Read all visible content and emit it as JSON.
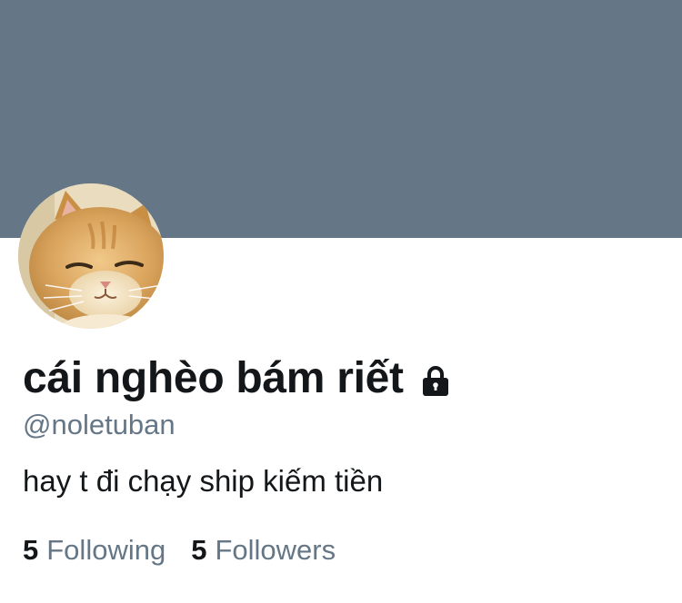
{
  "profile": {
    "banner_color": "#657786",
    "avatar_icon": "orange-cat-photo",
    "display_name": "cái nghèo bám riết",
    "protected_icon": "lock-icon",
    "handle": "@noletuban",
    "bio": "hay t đi chạy ship kiếm tiền"
  },
  "stats": {
    "following_count": "5",
    "following_label": "Following",
    "followers_count": "5",
    "followers_label": "Followers"
  },
  "colors": {
    "primary_text": "#14171a",
    "secondary_text": "#657786"
  }
}
